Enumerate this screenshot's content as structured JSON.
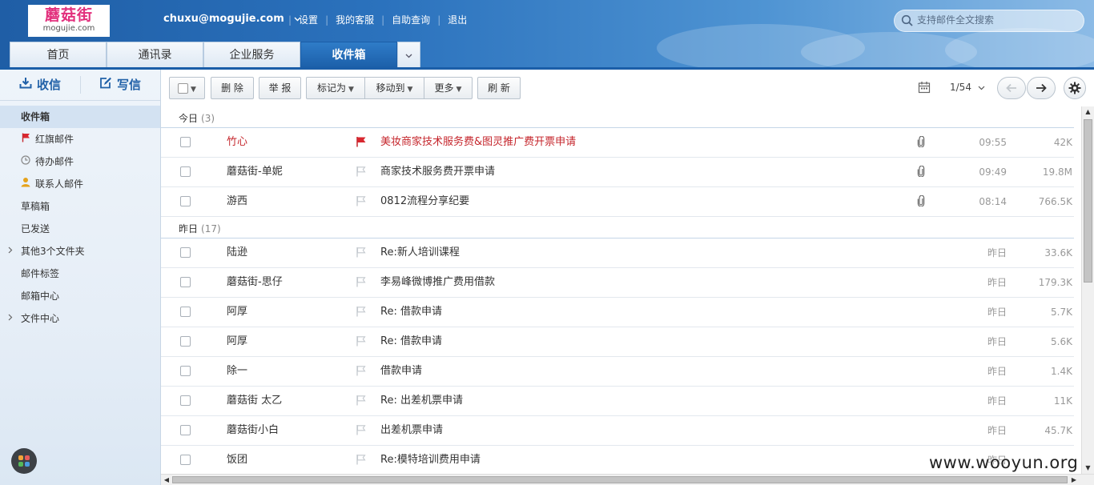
{
  "logo": {
    "cn": "蘑菇街",
    "en": "mogujie.com"
  },
  "header": {
    "user_email": "chuxu@mogujie.com",
    "links": [
      "设置",
      "我的客服",
      "自助查询",
      "退出"
    ],
    "search_placeholder": "支持邮件全文搜索"
  },
  "tabs": [
    "首页",
    "通讯录",
    "企业服务",
    "收件箱"
  ],
  "sidebar": {
    "receive_label": "收信",
    "compose_label": "写信",
    "folders": [
      {
        "label": "收件箱"
      },
      {
        "label": "红旗邮件",
        "icon": "red-flag-icon"
      },
      {
        "label": "待办邮件",
        "icon": "clock-icon"
      },
      {
        "label": "联系人邮件",
        "icon": "person-icon"
      },
      {
        "label": "草稿箱"
      },
      {
        "label": "已发送"
      },
      {
        "label": "其他3个文件夹"
      },
      {
        "label": "邮件标签"
      },
      {
        "label": "邮箱中心"
      },
      {
        "label": "文件中心"
      }
    ]
  },
  "toolbar": {
    "delete": "删 除",
    "report": "举 报",
    "mark_as": "标记为",
    "move_to": "移动到",
    "more": "更多",
    "refresh": "刷 新",
    "page": "1/54"
  },
  "groups": [
    {
      "label": "今日",
      "count": "(3)",
      "rows": [
        {
          "from": "竹心",
          "subject": "美妆商家技术服务费&图灵推广费开票申请",
          "time": "09:55",
          "size": "42K",
          "flagged": true,
          "attachment": true
        },
        {
          "from": "蘑菇街-单妮",
          "subject": "商家技术服务费开票申请",
          "time": "09:49",
          "size": "19.8M",
          "flagged": false,
          "attachment": true
        },
        {
          "from": "游西",
          "subject": "0812流程分享纪要",
          "time": "08:14",
          "size": "766.5K",
          "flagged": false,
          "attachment": true
        }
      ]
    },
    {
      "label": "昨日",
      "count": "(17)",
      "rows": [
        {
          "from": "陆逊",
          "subject": "Re:新人培训课程",
          "time": "昨日",
          "size": "33.6K",
          "flagged": false,
          "attachment": false
        },
        {
          "from": "蘑菇街-思仔",
          "subject": "李易峰微博推广费用借款",
          "time": "昨日",
          "size": "179.3K",
          "flagged": false,
          "attachment": false
        },
        {
          "from": "阿厚",
          "subject": "Re: 借款申请",
          "time": "昨日",
          "size": "5.7K",
          "flagged": false,
          "attachment": false
        },
        {
          "from": "阿厚",
          "subject": "Re: 借款申请",
          "time": "昨日",
          "size": "5.6K",
          "flagged": false,
          "attachment": false
        },
        {
          "from": "除一",
          "subject": "借款申请",
          "time": "昨日",
          "size": "1.4K",
          "flagged": false,
          "attachment": false
        },
        {
          "from": "蘑菇街 太乙",
          "subject": "Re: 出差机票申请",
          "time": "昨日",
          "size": "11K",
          "flagged": false,
          "attachment": false
        },
        {
          "from": "蘑菇街小白",
          "subject": "出差机票申请",
          "time": "昨日",
          "size": "45.7K",
          "flagged": false,
          "attachment": false
        },
        {
          "from": "饭团",
          "subject": "Re:模特培训费用申请",
          "time": "昨日",
          "size": "",
          "flagged": false,
          "attachment": false
        }
      ]
    }
  ],
  "watermark": "www.wooyun.org",
  "colors": {
    "brand_blue": "#1b5ea8",
    "flag_red": "#c5262c",
    "logo_pink": "#e22f7c"
  }
}
